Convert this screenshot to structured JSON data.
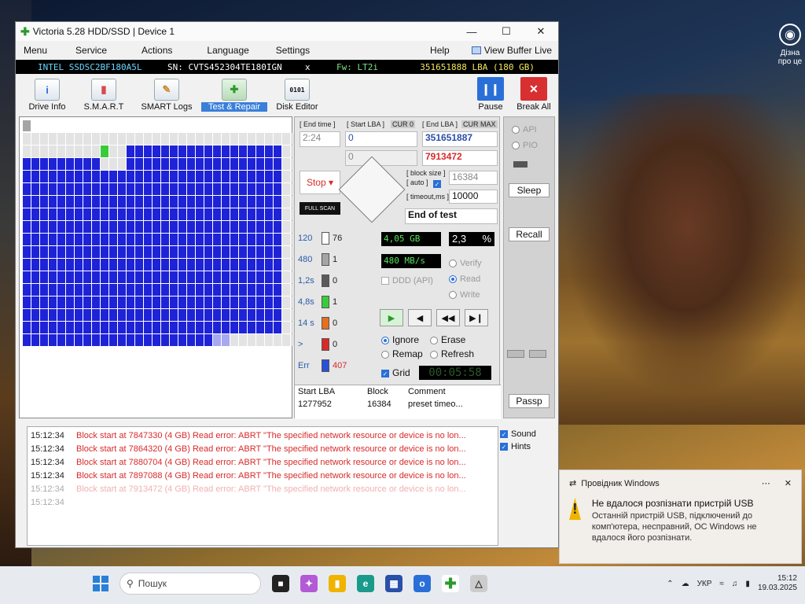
{
  "window": {
    "title": "Victoria 5.28 HDD/SSD | Device 1",
    "controls": {
      "minimize": "—",
      "maximize": "☐",
      "close": "✕"
    }
  },
  "menu": [
    "Menu",
    "Service",
    "Actions",
    "Language",
    "Settings",
    "Help"
  ],
  "view_buffer": "View Buffer Live",
  "drive": {
    "model": "INTEL SSDSC2BF180A5L",
    "serial": "SN: CVTS452304TE180IGN",
    "x": "x",
    "firmware": "Fw: LT2i",
    "lba": "351651888 LBA (180 GB)"
  },
  "toolbar": {
    "tabs": [
      {
        "label": "Drive Info",
        "icon": "info-icon"
      },
      {
        "label": "S.M.A.R.T",
        "icon": "smart-icon"
      },
      {
        "label": "SMART Logs",
        "icon": "logs-icon"
      },
      {
        "label": "Test & Repair",
        "icon": "repair-icon"
      },
      {
        "label": "Disk Editor",
        "icon": "disk-editor-icon"
      }
    ],
    "pause": "Pause",
    "break_all": "Break All"
  },
  "test": {
    "end_time_label": "[ End time ]",
    "start_lba_label": "[ Start LBA ]",
    "end_lba_label": "[ End LBA ]",
    "cur": "CUR",
    "zero": "0",
    "max": "MAX",
    "end_time": "2:24",
    "start_lba": "0",
    "end_lba": "351651887",
    "start_lba2": "0",
    "end_lba2": "7913472",
    "block_size_label": "[ block size ]",
    "auto_label": "[ auto ]",
    "block_size": "16384",
    "timeout_label": "[ timeout,ms ]",
    "timeout": "10000",
    "end_of_test": "End of test",
    "stop": "Stop",
    "full_scan": "FULL SCAN"
  },
  "legend": [
    {
      "label": "120",
      "count": "76",
      "color": "#ffffff"
    },
    {
      "label": "480",
      "count": "1",
      "color": "#a5a5a5"
    },
    {
      "label": "1,2s",
      "count": "0",
      "color": "#5a5a5a"
    },
    {
      "label": "4,8s",
      "count": "1",
      "color": "#38cd38"
    },
    {
      "label": "14 s",
      "count": "0",
      "color": "#e6701e"
    },
    {
      "label": ">",
      "count": "0",
      "color": "#d82a2a"
    },
    {
      "label": "Err",
      "count": "407",
      "color": "#2a4fd8"
    }
  ],
  "stats": {
    "size": "4,05 GB",
    "percent": "2,3",
    "pct_sign": "%",
    "speed": "480 MB/s",
    "ddd": "DDD (API)"
  },
  "mode": {
    "verify": "Verify",
    "read": "Read",
    "write": "Write"
  },
  "action": {
    "ignore": "Ignore",
    "erase": "Erase",
    "remap": "Remap",
    "refresh": "Refresh"
  },
  "grid_label": "Grid",
  "timer": "00:05:58",
  "table": {
    "headers": [
      "Start LBA",
      "Block",
      "Comment"
    ],
    "rows": [
      [
        "1277952",
        "16384",
        "preset timeo..."
      ]
    ]
  },
  "side": {
    "api": "API",
    "pio": "PIO",
    "sleep": "Sleep",
    "recall": "Recall",
    "passp": "Passp"
  },
  "log": [
    {
      "time": "15:12:34",
      "msg": "Block start at 7847330 (4 GB) Read error: ABRT \"The specified network resource or device is no lon..."
    },
    {
      "time": "15:12:34",
      "msg": "Block start at 7864320 (4 GB) Read error: ABRT \"The specified network resource or device is no lon..."
    },
    {
      "time": "15:12:34",
      "msg": "Block start at 7880704 (4 GB) Read error: ABRT \"The specified network resource or device is no lon..."
    },
    {
      "time": "15:12:34",
      "msg": "Block start at 7897088 (4 GB) Read error: ABRT \"The specified network resource or device is no lon..."
    },
    {
      "time": "15:12:34",
      "msg": "Block start at 7913472 (4 GB) Read error: ABRT \"The specified network resource or device is no lon..."
    },
    {
      "time": "15:12:34",
      "msg": ""
    }
  ],
  "log_options": {
    "sound": "Sound",
    "hints": "Hints"
  },
  "notification": {
    "app": "Провідник Windows",
    "title": "Не вдалося розпізнати пристрій USB",
    "text": "Останній пристрій USB, підключений до комп'ютера, несправний, ОС Windows не вдалося його розпізнати."
  },
  "desktop_icon_label": "Дізна про це",
  "taskbar": {
    "search_placeholder": "Пошук",
    "lang": "УКР",
    "time": "15:12",
    "date": "19.03.2025"
  }
}
